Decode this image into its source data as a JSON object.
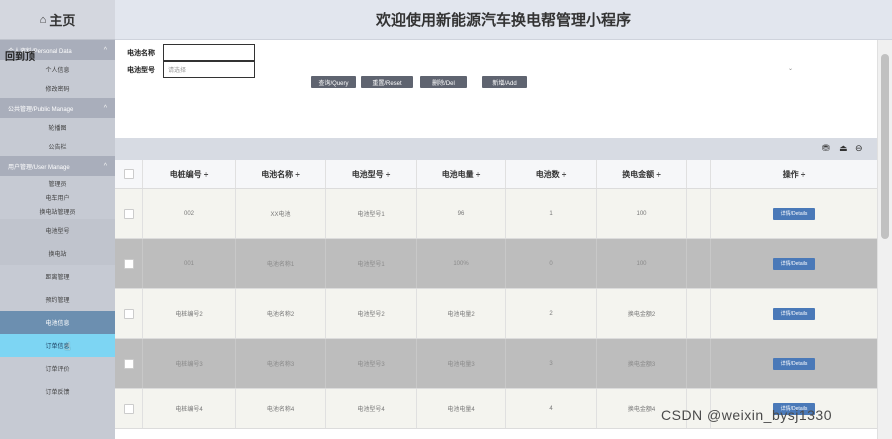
{
  "sidebar": {
    "home_icon": "⌂",
    "home_label": "主页",
    "personal_group": "个人资料/Personal Data",
    "personal_overlay": "回到顶",
    "personal_items": [
      "个人信息",
      "修改密码"
    ],
    "public_group": "公共管理/Public Manage",
    "public_items": [
      "轮播图",
      "公告栏"
    ],
    "user_group": "用户管理/User Manage",
    "user_items": [
      "管理员",
      "电车用户",
      "换电站管理员"
    ],
    "other_items": [
      "电池型号",
      "换电站",
      "距离管理",
      "预约管理",
      "电池信息",
      "订单信息",
      "订单评价",
      "订单反馈"
    ],
    "caret": "^"
  },
  "header": {
    "title": "欢迎使用新能源汽车换电帮管理小程序"
  },
  "search": {
    "name_label": "电池名称",
    "type_label": "电池型号",
    "type_placeholder": "请选择",
    "dropdown_arrow": "⌄",
    "query_button": "查询/Query",
    "reset_button": "重置/Reset",
    "delete_button": "删除/Del",
    "add_button": "新增/Add"
  },
  "toolbar": {
    "icons": [
      "filter-icon",
      "print-icon",
      "export-icon"
    ],
    "glyphs": [
      "⛃",
      "⏏",
      "⊖"
    ]
  },
  "table": {
    "headers": [
      "电桩编号 ÷",
      "电池名称 ÷",
      "电池型号 ÷",
      "电池电量 ÷",
      "电池数 ÷",
      "换电金额 ÷",
      "操作 ÷"
    ],
    "detail_label": "详情/Details",
    "rows": [
      [
        "002",
        "XX电池",
        "电池型号1",
        "96",
        "1",
        "100"
      ],
      [
        "001",
        "电池名称1",
        "电池型号1",
        "100%",
        "0",
        "100"
      ],
      [
        "电桩编号2",
        "电池名称2",
        "电池型号2",
        "电池电量2",
        "2",
        "换电金额2"
      ],
      [
        "电桩编号3",
        "电池名称3",
        "电池型号3",
        "电池电量3",
        "3",
        "换电金额3"
      ],
      [
        "电桩编号4",
        "电池名称4",
        "电池型号4",
        "电池电量4",
        "4",
        "换电金额4"
      ]
    ]
  },
  "watermark": "CSDN @weixin_bysj1330"
}
